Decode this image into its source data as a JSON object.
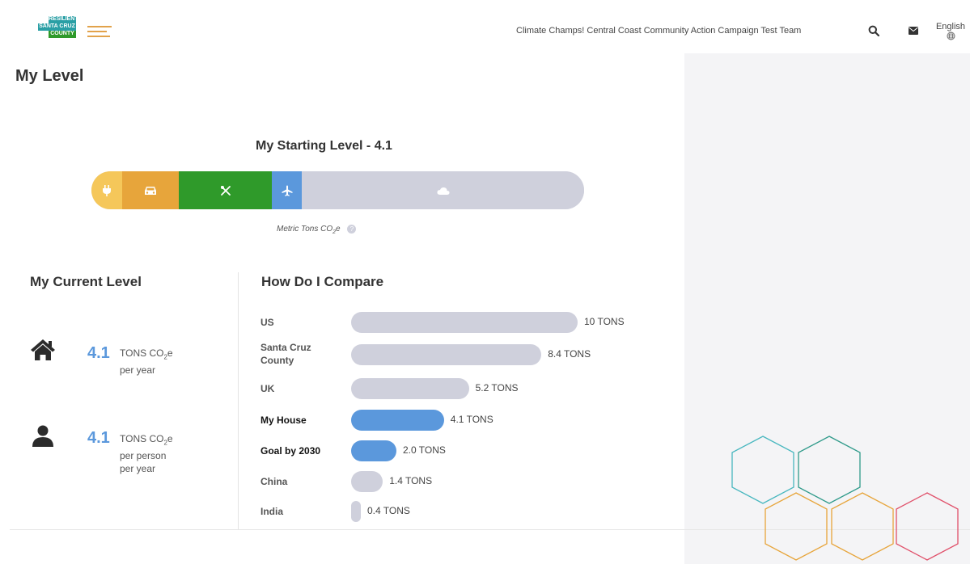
{
  "header": {
    "logo": {
      "line1": "RESILIENT",
      "line2": "SANTA CRUZ",
      "line3": "COUNTY"
    },
    "team_name": "Climate Champs! Central Coast Community Action Campaign Test Team",
    "search_icon": "search-icon",
    "mail_icon": "envelope-icon",
    "language": "English",
    "globe_icon": "globe-icon"
  },
  "page": {
    "title": "My Level"
  },
  "starting_level": {
    "title": "My Starting Level - 4.1",
    "segments": [
      {
        "name": "home-energy",
        "icon": "plug-icon",
        "color": "#f5c75a"
      },
      {
        "name": "transportation",
        "icon": "car-icon",
        "color": "#e7a53b"
      },
      {
        "name": "food",
        "icon": "utensils-icon",
        "color": "#2f9a2a"
      },
      {
        "name": "travel",
        "icon": "airplane-icon",
        "color": "#5b98dc"
      },
      {
        "name": "other",
        "icon": "cloud-icon",
        "color": "#cfd0dc"
      }
    ],
    "caption": "Metric Tons CO",
    "caption_sub": "2",
    "caption_suffix": "e",
    "help_icon": "question-icon"
  },
  "current_level": {
    "title": "My Current Level",
    "rows": [
      {
        "icon": "house-icon",
        "value": "4.1",
        "unit_a": "TONS CO",
        "unit_sub": "2",
        "unit_b": "e",
        "line2": "per year",
        "line3": ""
      },
      {
        "icon": "person-icon",
        "value": "4.1",
        "unit_a": "TONS CO",
        "unit_sub": "2",
        "unit_b": "e",
        "line2": "per person",
        "line3": "per year"
      }
    ]
  },
  "compare": {
    "title": "How Do I Compare",
    "rows": [
      {
        "label": "US",
        "tons": 10,
        "value_label": "10 TONS",
        "highlight": false
      },
      {
        "label": "Santa Cruz County",
        "tons": 8.4,
        "value_label": "8.4 TONS",
        "highlight": false
      },
      {
        "label": "UK",
        "tons": 5.2,
        "value_label": "5.2 TONS",
        "highlight": false
      },
      {
        "label": "My House",
        "tons": 4.1,
        "value_label": "4.1 TONS",
        "highlight": true
      },
      {
        "label": "Goal by 2030",
        "tons": 2.0,
        "value_label": "2.0 TONS",
        "highlight": true
      },
      {
        "label": "China",
        "tons": 1.4,
        "value_label": "1.4 TONS",
        "highlight": false
      },
      {
        "label": "India",
        "tons": 0.4,
        "value_label": "0.4 TONS",
        "highlight": false
      }
    ]
  },
  "colors": {
    "accent": "#5b98dc",
    "neutral_bar": "#cfd0dc",
    "teal": "#2a9fa5"
  }
}
